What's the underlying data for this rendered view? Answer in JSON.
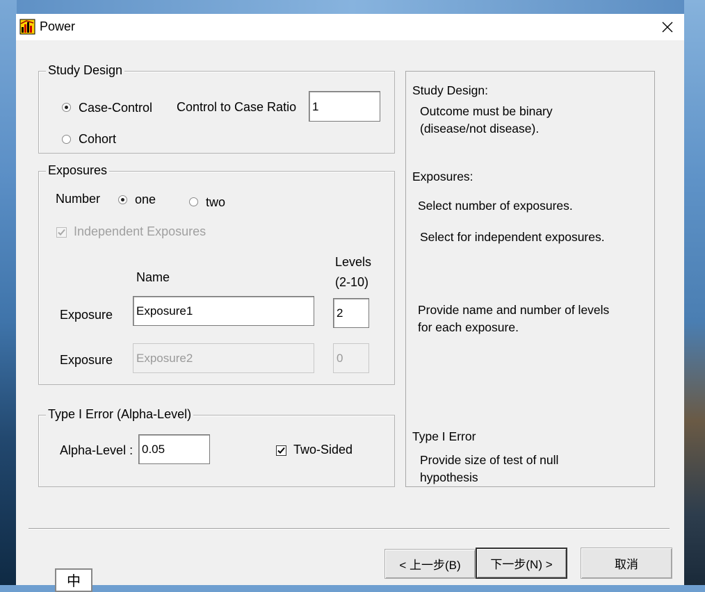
{
  "window": {
    "title": "Power",
    "close_glyph": "✕"
  },
  "study_design": {
    "legend": "Study Design",
    "case_control_label": "Case-Control",
    "ratio_label": "Control to Case Ratio",
    "ratio_value": "1",
    "cohort_label": "Cohort",
    "selected": "case-control"
  },
  "exposures": {
    "legend": "Exposures",
    "number_label": "Number",
    "one_label": "one",
    "two_label": "two",
    "independent_label": "Independent Exposures",
    "name_header": "Name",
    "levels_header_1": "Levels",
    "levels_header_2": "(2-10)",
    "rows": [
      {
        "label": "Exposure",
        "name": "Exposure1",
        "levels": "2",
        "enabled": true
      },
      {
        "label": "Exposure",
        "name": "Exposure2",
        "levels": "0",
        "enabled": false
      }
    ]
  },
  "type1": {
    "legend": "Type I Error (Alpha-Level)",
    "alpha_label": "Alpha-Level :",
    "alpha_value": "0.05",
    "two_sided_label": "Two-Sided",
    "two_sided_checked": true
  },
  "help": {
    "study_design_title": "Study Design:",
    "study_design_text_1": "Outcome must be binary",
    "study_design_text_2": "(disease/not disease).",
    "exposures_title": "Exposures:",
    "exposures_text_1": "Select number of exposures.",
    "exposures_text_2": "Select for independent exposures.",
    "exposures_text_3": "Provide name and number of levels",
    "exposures_text_4": "for each exposure.",
    "type1_title": "Type I Error",
    "type1_text_1": "Provide size of test of null",
    "type1_text_2": "hypothesis"
  },
  "buttons": {
    "back": "< 上一步(B)",
    "next": "下一步(N) >",
    "cancel": "取消"
  },
  "ime": {
    "label": "中"
  }
}
